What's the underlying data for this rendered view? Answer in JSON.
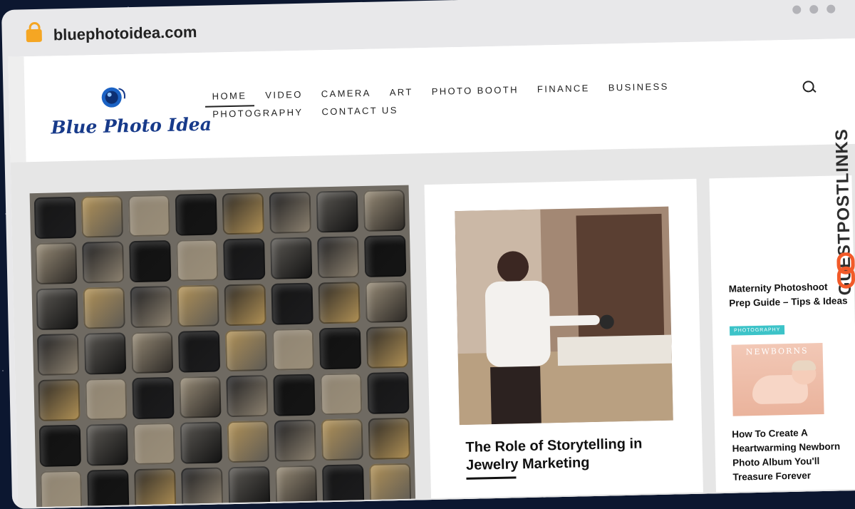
{
  "browser": {
    "url": "bluephotoidea.com"
  },
  "site": {
    "logo_text": "Blue Photo Idea",
    "nav_row1": [
      "HOME",
      "VIDEO",
      "CAMERA",
      "ART",
      "PHOTO BOOTH",
      "FINANCE",
      "BUSINESS"
    ],
    "nav_row2": [
      "PHOTOGRAPHY",
      "CONTACT US"
    ]
  },
  "main_article": {
    "title": "The Role of Storytelling in Jewelry Marketing"
  },
  "sidebar": {
    "post1_title": "Maternity Photoshoot Prep Guide – Tips & Ideas",
    "post1_category": "PHOTOGRAPHY",
    "post2_image_text": "NEWBORNS",
    "post2_title": "How To Create A Heartwarming Newborn Photo Album You'll Treasure Forever"
  },
  "watermark": {
    "text": "GUESTPOSTLINKS"
  },
  "colors": {
    "brand_blue": "#173a8a",
    "badge_teal": "#3cc3c8",
    "watermark_orange": "#f25a29"
  }
}
